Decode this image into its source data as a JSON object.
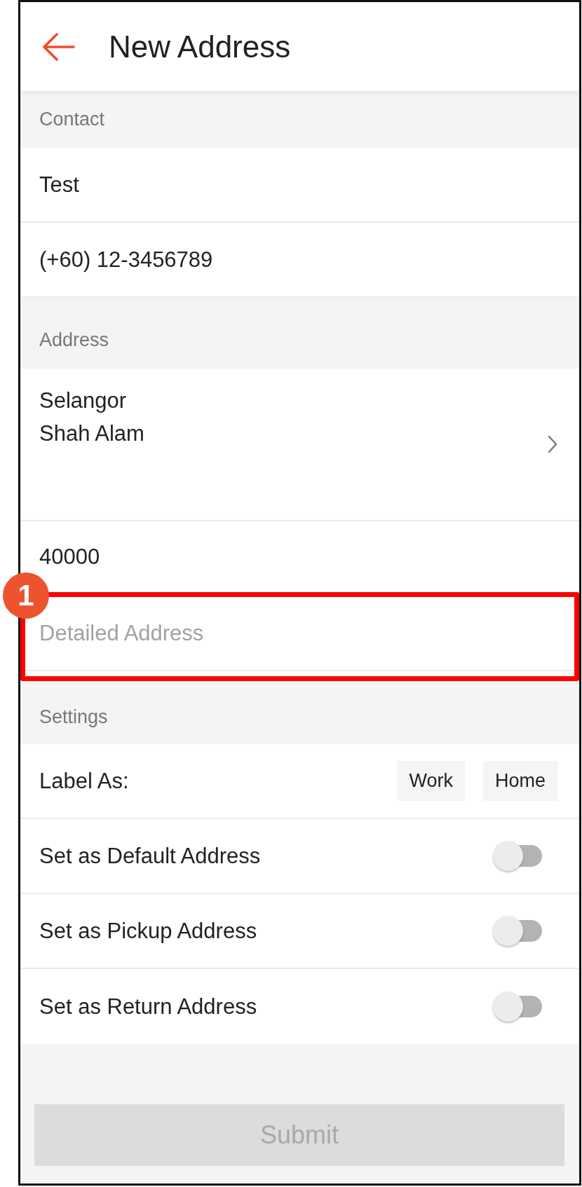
{
  "header": {
    "title": "New Address"
  },
  "sections": [
    {
      "title": "Contact",
      "rows": [
        {
          "kind": "field",
          "value": "Test"
        },
        {
          "kind": "field",
          "value": "(+60) 12-3456789"
        }
      ]
    },
    {
      "title": "Address",
      "rows": [
        {
          "kind": "picker",
          "lines": [
            "Selangor",
            "Shah Alam"
          ]
        },
        {
          "kind": "field",
          "value": "40000"
        },
        {
          "kind": "field",
          "placeholder": "Detailed Address",
          "annotation": "1"
        }
      ]
    },
    {
      "title": "Settings",
      "rows": [
        {
          "kind": "options",
          "label": "Label As:",
          "options": [
            {
              "label": "Work",
              "selected": false
            },
            {
              "label": "Home",
              "selected": false
            }
          ]
        },
        {
          "kind": "toggle",
          "label": "Set as Default Address",
          "on": false
        },
        {
          "kind": "toggle",
          "label": "Set as Pickup Address",
          "on": false
        },
        {
          "kind": "toggle",
          "label": "Set as Return Address",
          "on": false
        }
      ]
    }
  ],
  "submit": {
    "label": "Submit",
    "disabled": true
  }
}
